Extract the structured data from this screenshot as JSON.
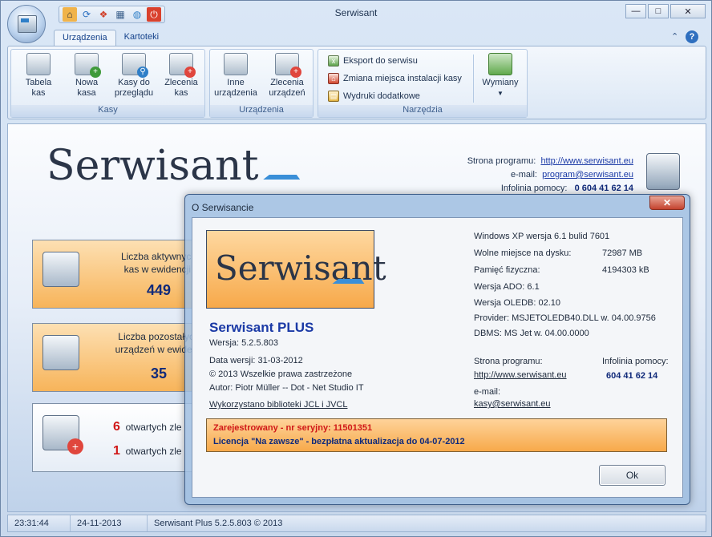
{
  "window": {
    "title": "Serwisant"
  },
  "quick_access": [
    "home-icon",
    "refresh-icon",
    "apps-icon",
    "calendar-icon",
    "globe-icon",
    "power-icon"
  ],
  "ribbon": {
    "tabs": [
      {
        "label": "Urządzenia"
      },
      {
        "label": "Kartoteki"
      }
    ],
    "groups": {
      "kasy": {
        "label": "Kasy",
        "buttons": [
          {
            "line1": "Tabela",
            "line2": "kas"
          },
          {
            "line1": "Nowa",
            "line2": "kasa"
          },
          {
            "line1": "Kasy do",
            "line2": "przeglądu"
          },
          {
            "line1": "Zlecenia",
            "line2": "kas"
          }
        ]
      },
      "urzadzenia": {
        "label": "Urządzenia",
        "buttons": [
          {
            "line1": "Inne",
            "line2": "urządzenia"
          },
          {
            "line1": "Zlecenia",
            "line2": "urządzeń"
          }
        ]
      },
      "narzedzia": {
        "label": "Narzędzia",
        "items": [
          "Eksport do serwisu",
          "Zmiana miejsca instalacji kasy",
          "Wydruki dodatkowe"
        ],
        "wymiany": "Wymiany"
      }
    }
  },
  "main": {
    "logo": "Serwisant",
    "contact": {
      "web_label": "Strona programu:",
      "web": "http://www.serwisant.eu",
      "email_label": "e-mail:",
      "email": "program@serwisant.eu",
      "hotline_label": "Infolinia pomocy:",
      "hotline": "0 604 41 62 14"
    },
    "tiles": [
      {
        "line1": "Liczba aktywnych",
        "line2": "kas w ewidencji:",
        "value": "449"
      },
      {
        "line1": "Liczba pozostałych",
        "line2": "urządzeń w ewidenc",
        "value": "35"
      }
    ],
    "orders": [
      {
        "count": "6",
        "text": "otwartych zle"
      },
      {
        "count": "1",
        "text": "otwartych zle"
      }
    ]
  },
  "status": {
    "time": "23:31:44",
    "date": "24-11-2013",
    "version": "Serwisant Plus 5.2.5.803 © 2013"
  },
  "dialog": {
    "title": "O Serwisancie",
    "close": "✕",
    "product": "Serwisant PLUS",
    "version": "Wersja: 5.2.5.803",
    "date": "Data wersji: 31-03-2012",
    "copyright": "© 2013 Wszelkie prawa zastrzeżone",
    "author": "Autor:  Piotr Müller -- Dot - Net Studio IT",
    "libs": "Wykorzystano biblioteki JCL i JVCL",
    "sys_os": "Windows XP wersja 6.1 bulid  7601",
    "sys_disk_label": "Wolne miejsce na dysku:",
    "sys_disk": "72987 MB",
    "sys_mem_label": "Pamięć fizyczna:",
    "sys_mem": "4194303 kB",
    "sys_ado": "Wersja ADO: 6.1",
    "sys_oledb": "Wersja OLEDB: 02.10",
    "sys_provider": "Provider: MSJETOLEDB40.DLL w. 04.00.9756",
    "sys_dbms": "DBMS: MS Jet w. 04.00.0000",
    "web_label": "Strona programu:",
    "web": "http://www.serwisant.eu",
    "hotline_label": "Infolinia pomocy:",
    "hotline": "604 41 62 14",
    "email_label": "e-mail:",
    "email": "kasy@serwisant.eu",
    "reg_line1": "Zarejestrowany - nr seryjny: 11501351",
    "reg_line2": "Licencja \"Na zawsze\" - bezpłatna aktualizacja do 04-07-2012",
    "ok": "Ok"
  },
  "colors": {
    "accent": "#1b3aa6",
    "orange": "#f7a94a",
    "red": "#d01818"
  }
}
